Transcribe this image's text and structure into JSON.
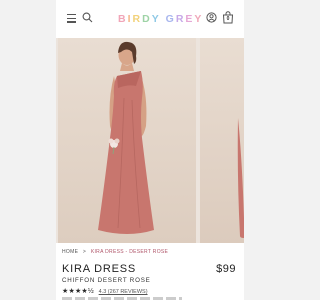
{
  "header": {
    "logo_letters": [
      {
        "char": "B",
        "color": "#f1a5b8"
      },
      {
        "char": "I",
        "color": "#f6b98d"
      },
      {
        "char": "R",
        "color": "#f2d27a"
      },
      {
        "char": "D",
        "color": "#9ed3a6"
      },
      {
        "char": "Y",
        "color": "#8fc9e6"
      },
      {
        "char": " ",
        "color": "#ffffff"
      },
      {
        "char": "G",
        "color": "#a8b6ee"
      },
      {
        "char": "R",
        "color": "#c7a9e8"
      },
      {
        "char": "E",
        "color": "#e6a7d6"
      },
      {
        "char": "Y",
        "color": "#f0a9b9"
      }
    ],
    "bag_count": "0",
    "icons": [
      "menu-icon",
      "search-icon",
      "account-icon",
      "shopping-bag-icon"
    ]
  },
  "gallery": {
    "dress_color": "#c8766e",
    "background_color": "#e6dacf"
  },
  "breadcrumb": {
    "home": "HOME",
    "separator": ">",
    "current": "KIRA DRESS - DESERT ROSE"
  },
  "product": {
    "name": "KIRA DRESS",
    "price": "$99",
    "subtitle": "CHIFFON DESERT ROSE",
    "stars": "★★★★½",
    "rating_value": 4.5,
    "reviews": "4.3 (267 REVIEWS)"
  }
}
